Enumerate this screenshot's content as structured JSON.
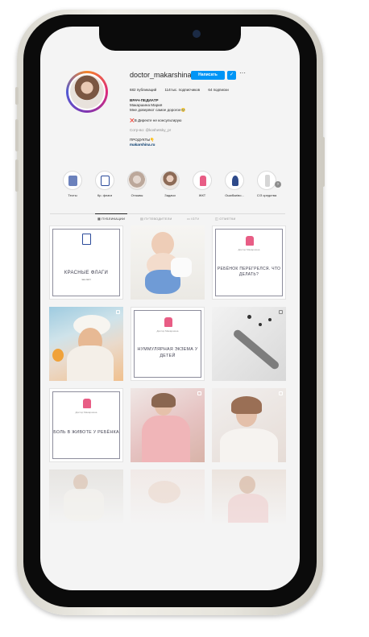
{
  "profile": {
    "username": "doctor_makarshina",
    "message_button": "Написать",
    "follow_icon": "person-check-icon",
    "more_label": "···",
    "stats": {
      "posts": "682 публикаций",
      "followers": "114тыс. подписчиков",
      "following": "64 подписки"
    },
    "bio": {
      "category": "ВРАЧ-ПЕДИАТР",
      "name": "Макаршина Мария",
      "tagline": "Мне доверяют самое дорогое🥹",
      "notice": "❌В Директе не консультирую",
      "collab": "Сотр-во: @koshetsky_pr",
      "products": "ПРОДУКТЫ👇",
      "website": "makarshina.ru"
    }
  },
  "highlights": [
    {
      "label": "Тесты",
      "color": "#3a57a6"
    },
    {
      "label": "Кр. флаги",
      "color": "#2b4b9a"
    },
    {
      "label": "Отзывы",
      "color": "#c9b7aa"
    },
    {
      "label": "Задачи",
      "color": "#b69a89"
    },
    {
      "label": "ЖКТ",
      "color": "#e85d85"
    },
    {
      "label": "Ошибки/во...",
      "color": "#2e4a8a"
    },
    {
      "label": "С/З средства",
      "color": "#d6d6d6"
    }
  ],
  "tabs": [
    {
      "label": "ПУБЛИКАЦИИ",
      "icon": "grid-icon",
      "active": true
    },
    {
      "label": "ПУТЕВОДИТЕЛИ",
      "icon": "guide-icon",
      "active": false
    },
    {
      "label": "IGTV",
      "icon": "igtv-icon",
      "active": false
    },
    {
      "label": "ОТМЕТКИ",
      "icon": "tag-icon",
      "active": false
    }
  ],
  "posts": [
    {
      "kind": "card",
      "title": "КРАСНЫЕ ФЛАГИ",
      "subtitle": "чек-лист",
      "icon": "document-icon"
    },
    {
      "kind": "photo",
      "alt": "baby-on-potty"
    },
    {
      "kind": "card",
      "brand": "Доктор Макаршина",
      "title": "РЕБЁНОК ПЕРЕГРЕЛСЯ. ЧТО ДЕЛАТЬ?"
    },
    {
      "kind": "photo",
      "alt": "woman-on-beach"
    },
    {
      "kind": "card",
      "brand": "Доктор Макаршина",
      "title": "НУММУЛЯРНАЯ ЭКЗЕМА У ДЕТЕЙ"
    },
    {
      "kind": "photo",
      "alt": "injection-pen"
    },
    {
      "kind": "card",
      "brand": "Доктор Макаршина",
      "title": "БОЛЬ В ЖИВОТЕ У РЕБЁНКА"
    },
    {
      "kind": "photo",
      "alt": "doctor-in-pink-coat"
    },
    {
      "kind": "photo",
      "alt": "doctor-portrait"
    },
    {
      "kind": "photo",
      "alt": "doctor-sitting"
    },
    {
      "kind": "photo",
      "alt": "baby-sleeping"
    },
    {
      "kind": "photo",
      "alt": "doctor-smiling"
    }
  ]
}
